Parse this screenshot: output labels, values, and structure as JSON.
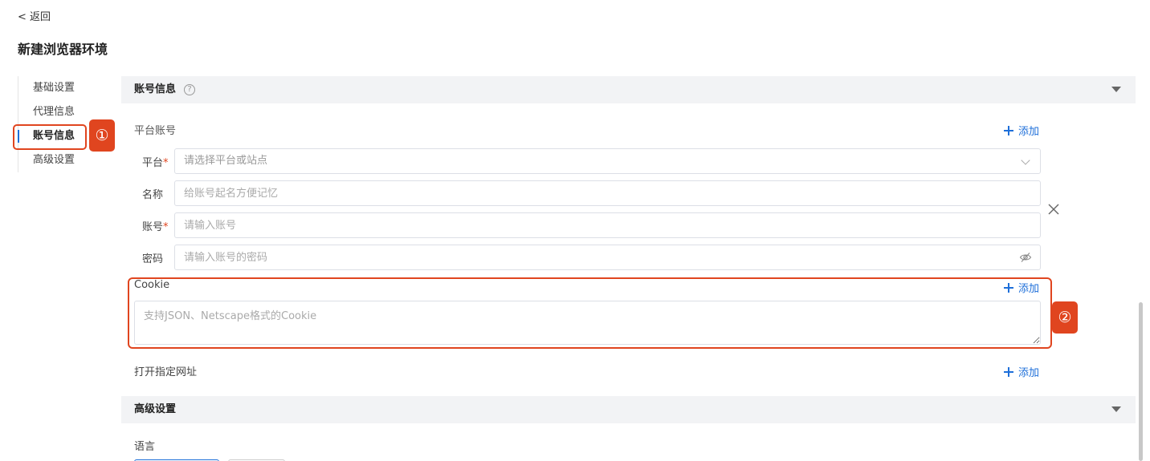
{
  "header": {
    "back_label": "< 返回",
    "title": "新建浏览器环境"
  },
  "sidebar": {
    "items": [
      {
        "label": "基础设置"
      },
      {
        "label": "代理信息"
      },
      {
        "label": "账号信息",
        "active": true
      },
      {
        "label": "高级设置"
      }
    ]
  },
  "annotations": {
    "badge1": "①",
    "badge2": "②"
  },
  "account_section": {
    "title": "账号信息",
    "help_icon": "question-circle-icon",
    "platform_account_label": "平台账号",
    "add_label": "添加",
    "fields": {
      "platform": {
        "label": "平台",
        "required_mark": "*",
        "placeholder": "请选择平台或站点"
      },
      "name": {
        "label": "名称",
        "placeholder": "给账号起名方便记忆"
      },
      "account": {
        "label": "账号",
        "required_mark": "*",
        "placeholder": "请输入账号"
      },
      "password": {
        "label": "密码",
        "placeholder": "请输入账号的密码"
      }
    },
    "cookie": {
      "label": "Cookie",
      "add_label": "添加",
      "placeholder": "支持JSON、Netscape格式的Cookie"
    },
    "open_url": {
      "label": "打开指定网址",
      "add_label": "添加"
    }
  },
  "advanced_section": {
    "title": "高级设置",
    "language_label": "语言"
  },
  "colors": {
    "accent": "#1e6fd9",
    "highlight": "#e0451f",
    "section_bg": "#f2f3f5"
  }
}
